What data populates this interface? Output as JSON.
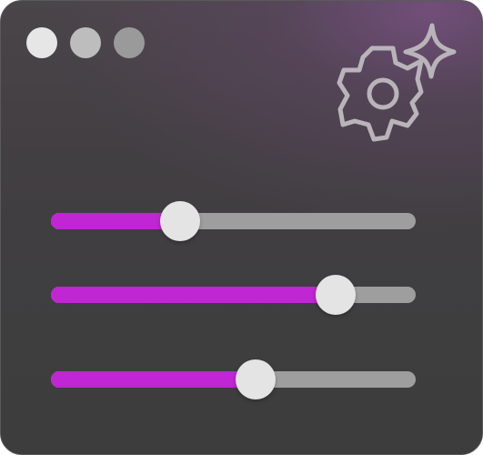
{
  "window": {
    "traffic_lights": [
      {
        "name": "close",
        "color": "#e6e6e6"
      },
      {
        "name": "minimize",
        "color": "#bdbdbd"
      },
      {
        "name": "zoom",
        "color": "#9a9a9a"
      }
    ]
  },
  "header_art": {
    "icons": [
      "gear-icon",
      "sparkle-icon"
    ],
    "stroke_color": "#b9b4ba"
  },
  "sliders": [
    {
      "name": "slider-1",
      "value": 0.355
    },
    {
      "name": "slider-2",
      "value": 0.78
    },
    {
      "name": "slider-3",
      "value": 0.56
    }
  ],
  "colors": {
    "fill": "#c026d3",
    "track": "#9e9e9e",
    "thumb": "#e4e4e4"
  }
}
